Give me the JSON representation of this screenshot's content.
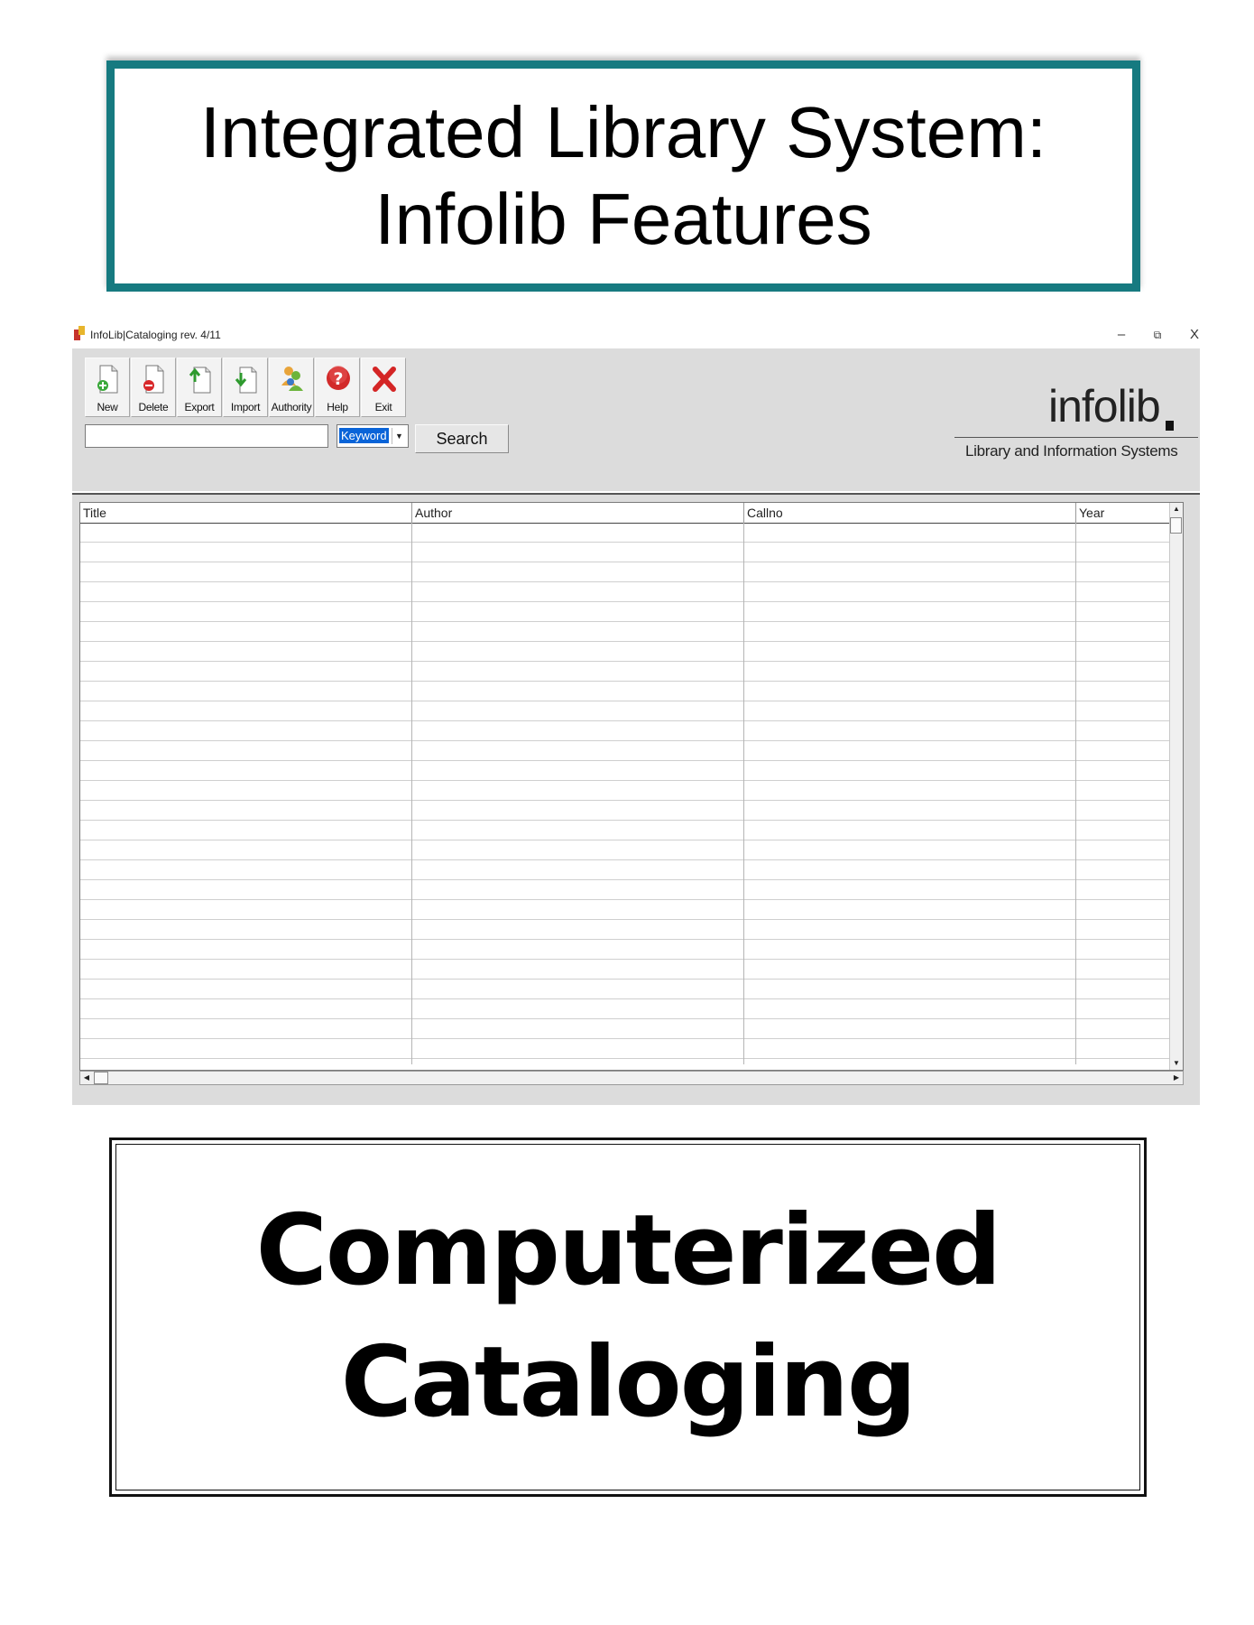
{
  "header": {
    "line1": "Integrated Library System:",
    "line2": "Infolib Features",
    "border_color": "#167a80"
  },
  "window": {
    "title": "InfoLib|Cataloging rev. 4/11",
    "icon": "app-logo-icon",
    "controls": {
      "minimize": "–",
      "maximize": "⧉",
      "close": "X"
    }
  },
  "toolbar": {
    "buttons": [
      {
        "label": "New",
        "icon": "new-document-icon"
      },
      {
        "label": "Delete",
        "icon": "delete-document-icon"
      },
      {
        "label": "Export",
        "icon": "export-document-icon"
      },
      {
        "label": "Import",
        "icon": "import-document-icon"
      },
      {
        "label": "Authority",
        "icon": "authority-users-icon"
      },
      {
        "label": "Help",
        "icon": "help-icon"
      },
      {
        "label": "Exit",
        "icon": "exit-icon"
      }
    ]
  },
  "search": {
    "value": "",
    "select_value": "Keyword",
    "button_label": "Search"
  },
  "logo": {
    "name": "infolib",
    "tagline": "Library and Information Systems"
  },
  "grid": {
    "columns": [
      "Title",
      "Author",
      "Callno",
      "Year"
    ],
    "rows": []
  },
  "footer": {
    "line1": "Computerized",
    "line2": "Cataloging"
  }
}
